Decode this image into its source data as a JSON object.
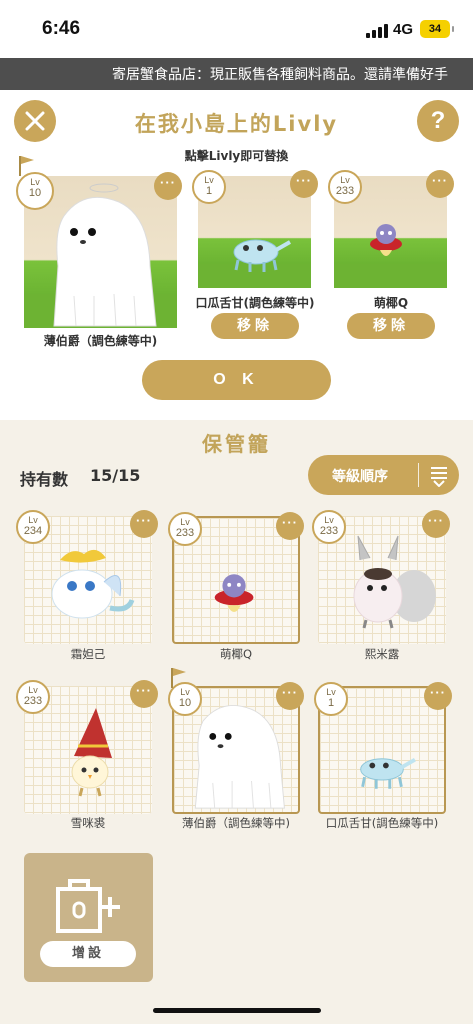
{
  "status_bar": {
    "time": "6:46",
    "network": "4G",
    "battery": "34"
  },
  "marquee": {
    "text": "寄居蟹食品店：現正販售各種飼料商品。還請準備好手"
  },
  "panel": {
    "title": "在我小島上的Livly",
    "subtitle": "點擊Livly即可替換",
    "help_label": "?",
    "ok_label": "O K",
    "lv_prefix": "Lv",
    "more_label": "···",
    "remove_label": "移除",
    "livlys": [
      {
        "level": "10",
        "name": "薄伯爵（調色練等中)",
        "flag": true
      },
      {
        "level": "1",
        "name": "口瓜舌甘(調色練等中)"
      },
      {
        "level": "233",
        "name": "萌椰Q"
      }
    ]
  },
  "storage": {
    "title": "保管籠",
    "count_label": "持有數",
    "count_value": "15/15",
    "sort_label": "等級順序",
    "add_label": "增設",
    "items": [
      {
        "level": "234",
        "name": "霜妲己"
      },
      {
        "level": "233",
        "name": "萌椰Q",
        "selected": true
      },
      {
        "level": "233",
        "name": "熙米露"
      },
      {
        "level": "233",
        "name": "雪咪裘"
      },
      {
        "level": "10",
        "name": "薄伯爵（調色練等中)",
        "selected": true,
        "flag": true
      },
      {
        "level": "1",
        "name": "口瓜舌甘(調色練等中)",
        "selected": true
      }
    ]
  },
  "colors": {
    "accent": "#c9a65a",
    "title": "#c2a45a",
    "background": "#f5f1e8",
    "marquee_bg": "#4e4e4e"
  }
}
